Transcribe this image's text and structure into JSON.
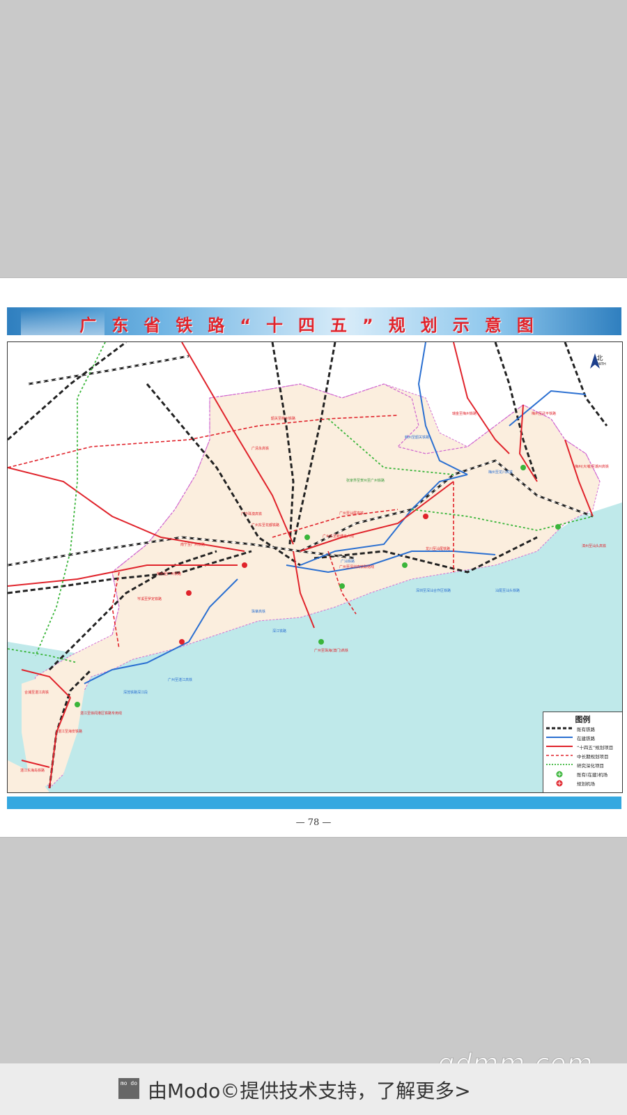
{
  "title": "广东省铁路“十四五”规划示意图",
  "page_number": "— 78 —",
  "north": {
    "cn": "北",
    "en": "NORTH"
  },
  "legend": {
    "title": "图例",
    "items": [
      {
        "label": "既有铁路",
        "color": "#222222",
        "style": "dashed-bw"
      },
      {
        "label": "在建铁路",
        "color": "#2a6fd1",
        "style": "solid"
      },
      {
        "label": "“十四五”规划项目",
        "color": "#e0232b",
        "style": "solid"
      },
      {
        "label": "中长期规划项目",
        "color": "#e0232b",
        "style": "dashed"
      },
      {
        "label": "研究深化项目",
        "color": "#3ab53a",
        "style": "dotted"
      },
      {
        "label": "既有(在建)机场",
        "color": "#3ab53a",
        "style": "airport"
      },
      {
        "label": "规划机场",
        "color": "#e0232b",
        "style": "airport"
      }
    ]
  },
  "map_labels": [
    {
      "text": "瑞金至梅州铁路",
      "cls": "red"
    },
    {
      "text": "梅州至武平铁路",
      "cls": "red"
    },
    {
      "text": "韶关至柳州铁路",
      "cls": "red"
    },
    {
      "text": "广清永高铁",
      "cls": "red"
    },
    {
      "text": "赣州至韶关铁路",
      "cls": "blue"
    },
    {
      "text": "广中珠澳高铁",
      "cls": "red"
    },
    {
      "text": "广州东至花都铁路",
      "cls": "red"
    },
    {
      "text": "广州至汕尾高铁",
      "cls": "red"
    },
    {
      "text": "广州东至新塘五六线",
      "cls": "red"
    },
    {
      "text": "梅州至龙川高铁",
      "cls": "blue"
    },
    {
      "text": "梅州(大埔)至潮州高铁",
      "cls": "red"
    },
    {
      "text": "漳州至汕头高铁",
      "cls": "red"
    },
    {
      "text": "南宁至广州铁路",
      "cls": "red"
    },
    {
      "text": "深江铁路",
      "cls": "blue"
    },
    {
      "text": "龙川至汕尾铁路",
      "cls": "red"
    },
    {
      "text": "广州至深圳高铁联络线",
      "cls": "red"
    },
    {
      "text": "汕尾至汕头铁路",
      "cls": "blue"
    },
    {
      "text": "深圳至深汕合作区铁路",
      "cls": "blue"
    },
    {
      "text": "广州至珠海(澳门)高铁",
      "cls": "red"
    },
    {
      "text": "珠肇高铁",
      "cls": "blue"
    },
    {
      "text": "广州至湛江高铁",
      "cls": "blue"
    },
    {
      "text": "湛江至海安铁路",
      "cls": "red"
    },
    {
      "text": "合浦至湛江高铁",
      "cls": "red"
    },
    {
      "text": "湛江至徐闻港区铁路专用线",
      "cls": "red"
    },
    {
      "text": "湛江东海岛铁路",
      "cls": "red"
    },
    {
      "text": "柳州至广州铁路",
      "cls": "red"
    },
    {
      "text": "深茂铁路深江段",
      "cls": "blue"
    },
    {
      "text": "张家界至贺州至广州铁路",
      "cls": "green"
    },
    {
      "text": "岑溪至罗定铁路",
      "cls": "red"
    },
    {
      "text": "广汕铁路",
      "cls": "blue"
    }
  ],
  "footer": {
    "logo": "mo do",
    "text": "由Modo©提供技术支持，了解更多>",
    "watermark": "gdmm.com"
  }
}
